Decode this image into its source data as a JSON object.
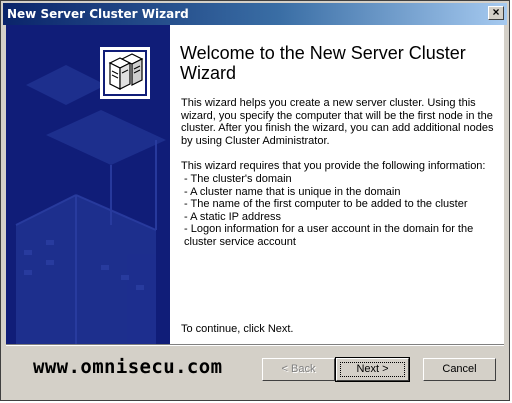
{
  "window": {
    "title": "New Server Cluster Wizard",
    "close_glyph": "×"
  },
  "content": {
    "heading": "Welcome to the New Server Cluster Wizard",
    "intro": "This wizard helps you create a new server cluster. Using this wizard, you specify the computer that will be the first node in the cluster. After you finish the wizard, you can add additional nodes by using Cluster Administrator.",
    "requirements_intro": "This wizard requires that you provide the following information:",
    "requirements": [
      "- The cluster's domain",
      "- A cluster name that is unique in the domain",
      "- The name of the first computer to be added to the cluster",
      "- A static IP address",
      "- Logon information for a user account in the domain for the cluster service account"
    ],
    "continue_text": "To continue, click Next."
  },
  "footer": {
    "watermark": "www.omnisecu.com",
    "back_label": "< Back",
    "next_label": "Next >",
    "cancel_label": "Cancel"
  },
  "icon": "server-cluster-icon"
}
